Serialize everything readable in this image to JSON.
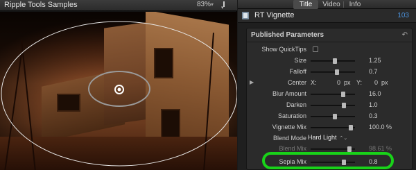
{
  "viewer": {
    "title": "Ripple Tools Samples",
    "zoom": "83%"
  },
  "inspector": {
    "tabs": [
      {
        "label": "Title",
        "active": true
      },
      {
        "label": "Video",
        "active": false
      },
      {
        "label": "Info",
        "active": false
      }
    ],
    "effect_name": "RT Vignette",
    "effect_count": "103",
    "panel_title": "Published Parameters",
    "params": {
      "show_quicktips": {
        "label": "Show QuickTips",
        "checked": false
      },
      "size": {
        "label": "Size",
        "value": "1.25",
        "fraction": 0.55
      },
      "falloff": {
        "label": "Falloff",
        "value": "0.7",
        "fraction": 0.6
      },
      "center": {
        "label": "Center",
        "x_label": "X:",
        "x_value": "0",
        "x_unit": "px",
        "y_label": "Y:",
        "y_value": "0",
        "y_unit": "px"
      },
      "blur_amount": {
        "label": "Blur Amount",
        "value": "16.0",
        "fraction": 0.75
      },
      "darken": {
        "label": "Darken",
        "value": "1.0",
        "fraction": 0.78
      },
      "saturation": {
        "label": "Saturation",
        "value": "0.3",
        "fraction": 0.55
      },
      "vignette_mix": {
        "label": "Vignette Mix",
        "value": "100.0",
        "unit": "%",
        "fraction": 0.95
      },
      "blend_mode": {
        "label": "Blend Mode",
        "value": "Hard Light"
      },
      "blend_mix": {
        "label": "Blend Mix",
        "value": "98.61",
        "unit": "%",
        "fraction": 0.92
      },
      "sepia_mix": {
        "label": "Sepia Mix",
        "value": "0.8",
        "fraction": 0.78
      }
    }
  },
  "colors": {
    "highlight": "#19d219",
    "accent": "#4a90d9"
  }
}
